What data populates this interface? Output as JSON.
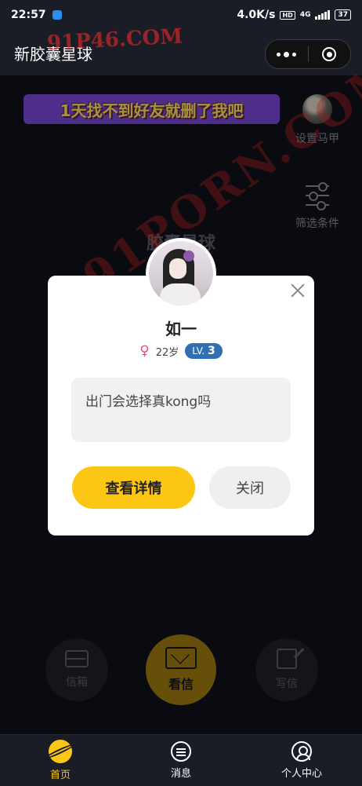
{
  "status_bar": {
    "time": "22:57",
    "net_speed": "4.0K/s",
    "hd": "HD",
    "network": "4G",
    "battery": "37"
  },
  "app_bar": {
    "title": "新胶囊星球"
  },
  "watermarks": {
    "top": "91P46.COM",
    "diagonal": "91PORN.COM"
  },
  "banner": {
    "text": "1天找不到好友就删了我吧"
  },
  "side": {
    "set_alias_label": "设置马甲",
    "filter_label": "筛选条件"
  },
  "background_title": "胶囊星球",
  "modal": {
    "name": "如一",
    "age": "22岁",
    "level_prefix": "LV.",
    "level_value": "3",
    "message": "出门会选择真kong吗",
    "detail_button": "查看详情",
    "close_button": "关闭"
  },
  "actions": {
    "inbox": "信箱",
    "view_letter": "看信",
    "write_letter": "写信"
  },
  "tabs": [
    {
      "label": "首页",
      "active": true
    },
    {
      "label": "消息",
      "active": false
    },
    {
      "label": "个人中心",
      "active": false
    }
  ],
  "colors": {
    "accent": "#fcc614",
    "banner_bg": "#7748d6",
    "level_badge": "#2f6fb3",
    "female": "#e84a7a"
  }
}
